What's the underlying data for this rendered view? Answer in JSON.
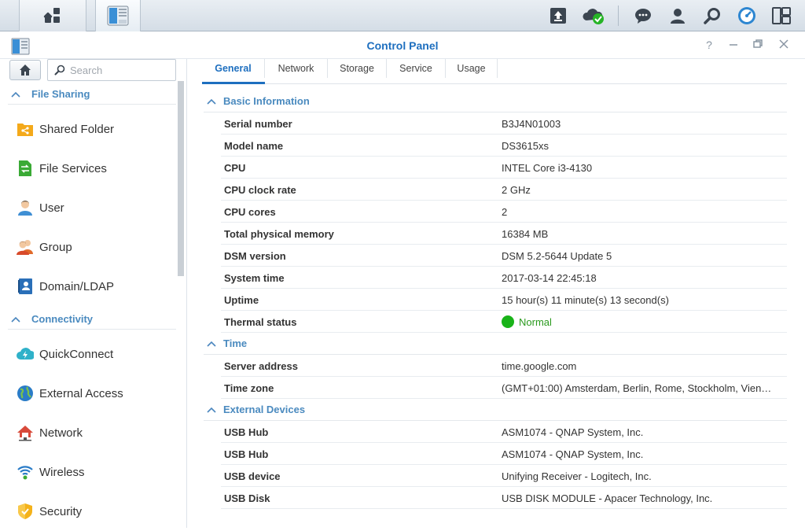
{
  "window": {
    "title": "Control Panel"
  },
  "sidebar": {
    "search_placeholder": "Search",
    "categories": [
      {
        "label": "File Sharing"
      },
      {
        "label": "Connectivity"
      }
    ],
    "items": [
      {
        "label": "Shared Folder",
        "icon": "shared-folder-icon"
      },
      {
        "label": "File Services",
        "icon": "file-services-icon"
      },
      {
        "label": "User",
        "icon": "user-icon"
      },
      {
        "label": "Group",
        "icon": "group-icon"
      },
      {
        "label": "Domain/LDAP",
        "icon": "domain-ldap-icon"
      },
      {
        "label": "QuickConnect",
        "icon": "quickconnect-icon"
      },
      {
        "label": "External Access",
        "icon": "external-access-icon"
      },
      {
        "label": "Network",
        "icon": "network-icon"
      },
      {
        "label": "Wireless",
        "icon": "wireless-icon"
      },
      {
        "label": "Security",
        "icon": "security-icon"
      }
    ]
  },
  "tabs": [
    {
      "label": "General",
      "active": true
    },
    {
      "label": "Network"
    },
    {
      "label": "Storage"
    },
    {
      "label": "Service"
    },
    {
      "label": "Usage"
    }
  ],
  "sections": {
    "basic": {
      "title": "Basic Information",
      "rows": [
        {
          "key": "Serial number",
          "value": "B3J4N01003"
        },
        {
          "key": "Model name",
          "value": "DS3615xs"
        },
        {
          "key": "CPU",
          "value": "INTEL Core i3-4130"
        },
        {
          "key": "CPU clock rate",
          "value": "2 GHz"
        },
        {
          "key": "CPU cores",
          "value": "2"
        },
        {
          "key": "Total physical memory",
          "value": "16384 MB"
        },
        {
          "key": "DSM version",
          "value": "DSM 5.2-5644 Update 5"
        },
        {
          "key": "System time",
          "value": "2017-03-14 22:45:18"
        },
        {
          "key": "Uptime",
          "value": "15 hour(s) 11 minute(s) 13 second(s)"
        },
        {
          "key": "Thermal status",
          "value": "Normal"
        }
      ]
    },
    "time": {
      "title": "Time",
      "rows": [
        {
          "key": "Server address",
          "value": "time.google.com"
        },
        {
          "key": "Time zone",
          "value": "(GMT+01:00) Amsterdam, Berlin, Rome, Stockholm, Vien…"
        }
      ]
    },
    "external": {
      "title": "External Devices",
      "rows": [
        {
          "key": "USB Hub",
          "value": "ASM1074 - QNAP System, Inc."
        },
        {
          "key": "USB Hub",
          "value": "ASM1074 - QNAP System, Inc."
        },
        {
          "key": "USB device",
          "value": "Unifying Receiver - Logitech, Inc."
        },
        {
          "key": "USB Disk",
          "value": "USB DISK MODULE - Apacer Technology, Inc."
        }
      ]
    }
  },
  "colors": {
    "accent": "#1e6fbf",
    "section": "#4a8abf",
    "status_ok": "#19b319"
  }
}
